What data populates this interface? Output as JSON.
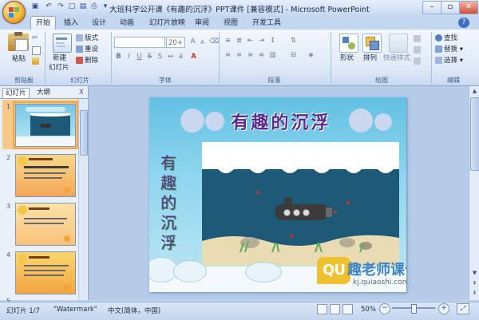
{
  "window": {
    "title": "大班科学公开课《有趣的沉浮》PPT课件 [兼容模式] - Microsoft PowerPoint"
  },
  "tabs": [
    "开始",
    "插入",
    "设计",
    "动画",
    "幻灯片放映",
    "审阅",
    "视图",
    "开发工具"
  ],
  "ribbon": {
    "clipboard": {
      "paste": "粘贴",
      "label": "剪贴板"
    },
    "slides": {
      "new_slide_l1": "新建",
      "new_slide_l2": "幻灯片",
      "layout": "版式",
      "reset": "重设",
      "delete": "删除",
      "label": "幻灯片"
    },
    "font": {
      "font_size": "20+",
      "label": "字体"
    },
    "paragraph": {
      "label": "段落"
    },
    "drawing": {
      "shape": "形状",
      "arrange": "排列",
      "quick_styles": "快速样式",
      "label": "绘图"
    },
    "editing": {
      "find": "查找",
      "replace": "替换",
      "select": "选择",
      "label": "编辑"
    }
  },
  "panel": {
    "tab_slides": "幻灯片",
    "tab_outline": "大纲",
    "close": "X",
    "thumb_numbers": [
      "1",
      "2",
      "3",
      "4",
      "5"
    ]
  },
  "slide": {
    "title": "有趣的沉浮",
    "vertical_title": [
      "有",
      "趣",
      "的",
      "沉",
      "浮"
    ],
    "watermark_logo": "QU",
    "watermark_brand": "趣老师课件",
    "watermark_url": "kj.quiaoshi.com"
  },
  "status": {
    "slide_pos": "幻灯片 1/7",
    "theme": "\"Watermark\"",
    "language": "中文(简体，中国)",
    "zoom": "50%"
  },
  "colors": {
    "accent_orange": "#f2a541",
    "ribbon_blue": "#dfe9f7",
    "sea": "#1d5a78",
    "title_purple": "#5a2b8f"
  }
}
